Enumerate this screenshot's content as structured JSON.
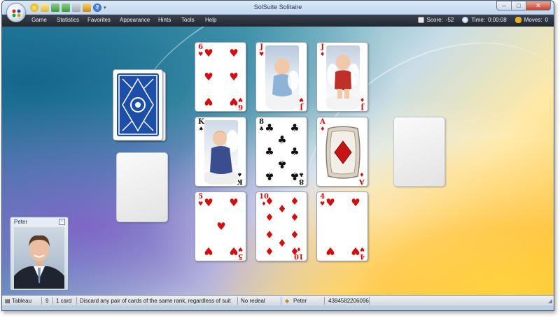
{
  "window": {
    "title": "SolSuite Solitaire"
  },
  "window_buttons": {
    "minimize": "–",
    "maximize": "□",
    "close": "✕"
  },
  "menu": [
    "Game",
    "Statistics",
    "Favorites",
    "Appearance",
    "Hints",
    "Tools",
    "Help"
  ],
  "stats": {
    "score_label": "Score:",
    "score": "-52",
    "time_label": "Time:",
    "time": "0:00:08",
    "moves_label": "Moves:",
    "moves": "0"
  },
  "tableau": [
    {
      "rank": "6",
      "suit": "♥",
      "color": "red"
    },
    {
      "rank": "J",
      "suit": "♥",
      "color": "red"
    },
    {
      "rank": "J",
      "suit": "♦",
      "color": "red"
    },
    {
      "rank": "K",
      "suit": "♠",
      "color": "black"
    },
    {
      "rank": "8",
      "suit": "♣",
      "color": "black"
    },
    {
      "rank": "A",
      "suit": "♦",
      "color": "red"
    },
    {
      "rank": "5",
      "suit": "♥",
      "color": "red"
    },
    {
      "rank": "10",
      "suit": "♦",
      "color": "red"
    },
    {
      "rank": "4",
      "suit": "♥",
      "color": "red"
    }
  ],
  "player": {
    "name": "Peter"
  },
  "statusbar": {
    "game": "Tableau",
    "cards_left": "9",
    "selection": "1 card",
    "rule": "Discard any pair of cards of the same rank, regardless of suit",
    "redeal": "No redeal",
    "player": "Peter",
    "game_number": "4384582206096"
  },
  "colors": {
    "menubar": "#2b313a",
    "card_back": "#1d4fa8",
    "red_suit": "#d01010"
  }
}
